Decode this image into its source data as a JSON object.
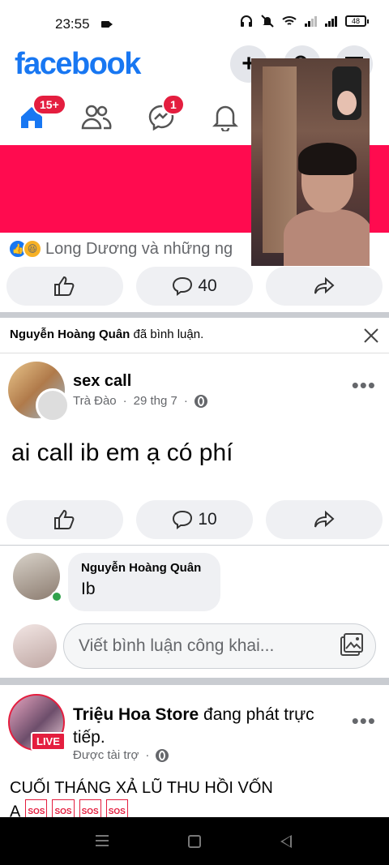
{
  "status_bar": {
    "time": "23:55",
    "battery": "48"
  },
  "header": {
    "logo": "facebook",
    "create_label": "+",
    "brand_color": "#1877f2"
  },
  "nav": {
    "home_badge": "15+",
    "messenger_badge": "1"
  },
  "top_post": {
    "reaction_text": "Long Dương và những ng",
    "comment_count": "40"
  },
  "notification": {
    "actor": "Nguyễn Hoàng Quân",
    "action": " đã bình luận."
  },
  "post": {
    "title": "sex call",
    "author": "Trà Đào",
    "date": "29 thg 7",
    "separator": "·",
    "body": "ai call ib em ạ có phí",
    "comment_count": "10"
  },
  "comment": {
    "name": "Nguyễn Hoàng Quân",
    "text": "Ib"
  },
  "comment_input": {
    "placeholder": "Viết bình luận công khai..."
  },
  "sponsored_post": {
    "page_name": "Triệu Hoa Store",
    "action": " đang phát trực tiếp.",
    "live_badge": "LIVE",
    "sponsored_label": "Được tài trợ",
    "separator": "·",
    "body": "CUỐI THÁNG XẢ LŨ THU HỒI VỐN",
    "body_line2": "Ạ",
    "sos_label": "SOS"
  },
  "colors": {
    "banner": "#ff0b4f",
    "badge": "#e41e3f",
    "online": "#31a24c"
  }
}
